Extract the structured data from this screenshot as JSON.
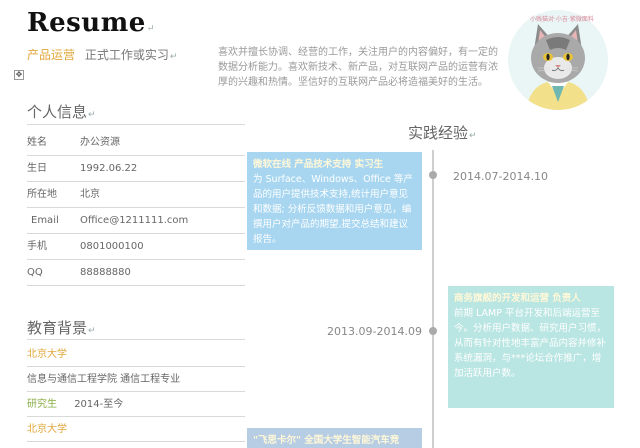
{
  "header": {
    "title": "Resume",
    "role": "产品运营",
    "job_type": "正式工作或实习",
    "intro": "喜欢并擅长协调、经营的工作，关注用户的内容偏好，有一定的数据分析能力。喜欢新技术、新产品，对互联网产品的运营有浓厚的兴趣和热情。坚信好的互联网产品必将造福美好的生活。",
    "avatar_tag": "小贱猫对·小吉·紫微面料"
  },
  "personal": {
    "heading": "个人信息",
    "rows": [
      {
        "label": "姓名",
        "value": "办公资源"
      },
      {
        "label": "生日",
        "value": "1992.06.22"
      },
      {
        "label": "所在地",
        "value": "北京"
      },
      {
        "label": "Email",
        "value": "Office@1211111.com"
      },
      {
        "label": "手机",
        "value": "0801000100"
      },
      {
        "label": "QQ",
        "value": "88888880"
      }
    ]
  },
  "education": {
    "heading": "教育背景",
    "rows": [
      {
        "text": "北京大学"
      },
      {
        "text": "信息与通信工程学院 通信工程专业"
      },
      {
        "degree": "研究生",
        "period": "2014-至今"
      },
      {
        "text": "北京大学"
      }
    ]
  },
  "experience": {
    "heading": "实践经验",
    "items": [
      {
        "head": "微软在线 产品技术支持 实习生",
        "body": "为 Surface、Windows、Office 等产品的用户提供技术支持,统计用户意见和数据; 分析反馈数据和用户意见，编撰用户对产品的期望,提交总结和建议报告。",
        "date": "2014.07-2014.10"
      },
      {
        "head": "商务旗舰的开发和运营 负责人",
        "body": "前期 LAMP 平台开发和后端运营至今。分析用户数据、研究用户习惯，从而有针对性地丰富产品内容并修补系统漏洞，与***论坛合作推广，增加活跃用户数。",
        "date": "2013.09-2014.09"
      },
      {
        "head": "\"飞思卡尔\" 全国大学生智能汽车竞"
      }
    ]
  },
  "colors": {
    "accent_orange": "#e0a73a",
    "accent_green": "#8aae45",
    "card_blue": "#a8d6f0",
    "card_mint": "#b9e5e2"
  }
}
